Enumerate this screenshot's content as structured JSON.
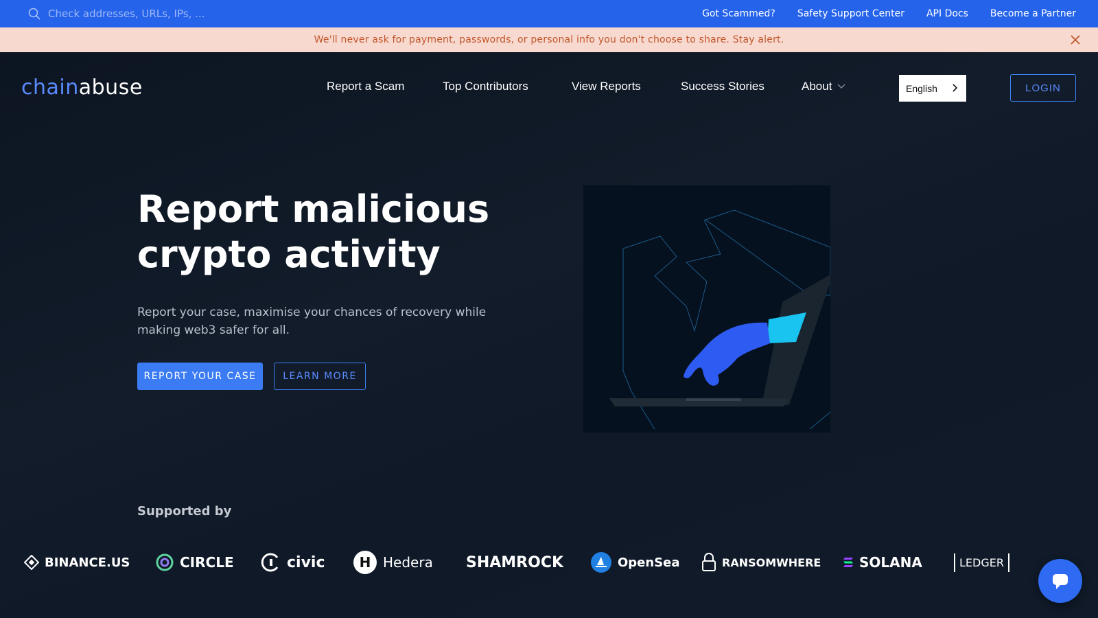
{
  "topbar": {
    "search_placeholder": "Check addresses, URLs, IPs, ...",
    "links": [
      "Got Scammed?",
      "Safety Support Center",
      "API Docs",
      "Become a Partner"
    ]
  },
  "alert": {
    "message": "We'll never ask for payment, passwords, or personal info you don't choose to share. Stay alert."
  },
  "nav": {
    "logo_part1": "chain",
    "logo_part2": "abuse",
    "links": [
      "Report a Scam",
      "Top Contributors",
      "View Reports",
      "Success Stories",
      "About"
    ],
    "language": "English",
    "login": "LOGIN"
  },
  "hero": {
    "title_line1": "Report malicious",
    "title_line2": "crypto activity",
    "subtitle": "Report your case, maximise your chances of recovery while making web3 safer for all.",
    "primary_button": "REPORT YOUR CASE",
    "secondary_button": "LEARN MORE"
  },
  "supported": {
    "heading": "Supported by",
    "partners": [
      "BINANCE.US",
      "CIRCLE",
      "civic",
      "Hedera",
      "SHAMROCK",
      "OpenSea",
      "RANSOMWHERE",
      "SOLANA",
      "LEDGER"
    ]
  },
  "colors": {
    "accent": "#2563eb",
    "alert_bg": "#f7d9cf",
    "alert_text": "#c2562b",
    "bg": "#0d1624"
  }
}
